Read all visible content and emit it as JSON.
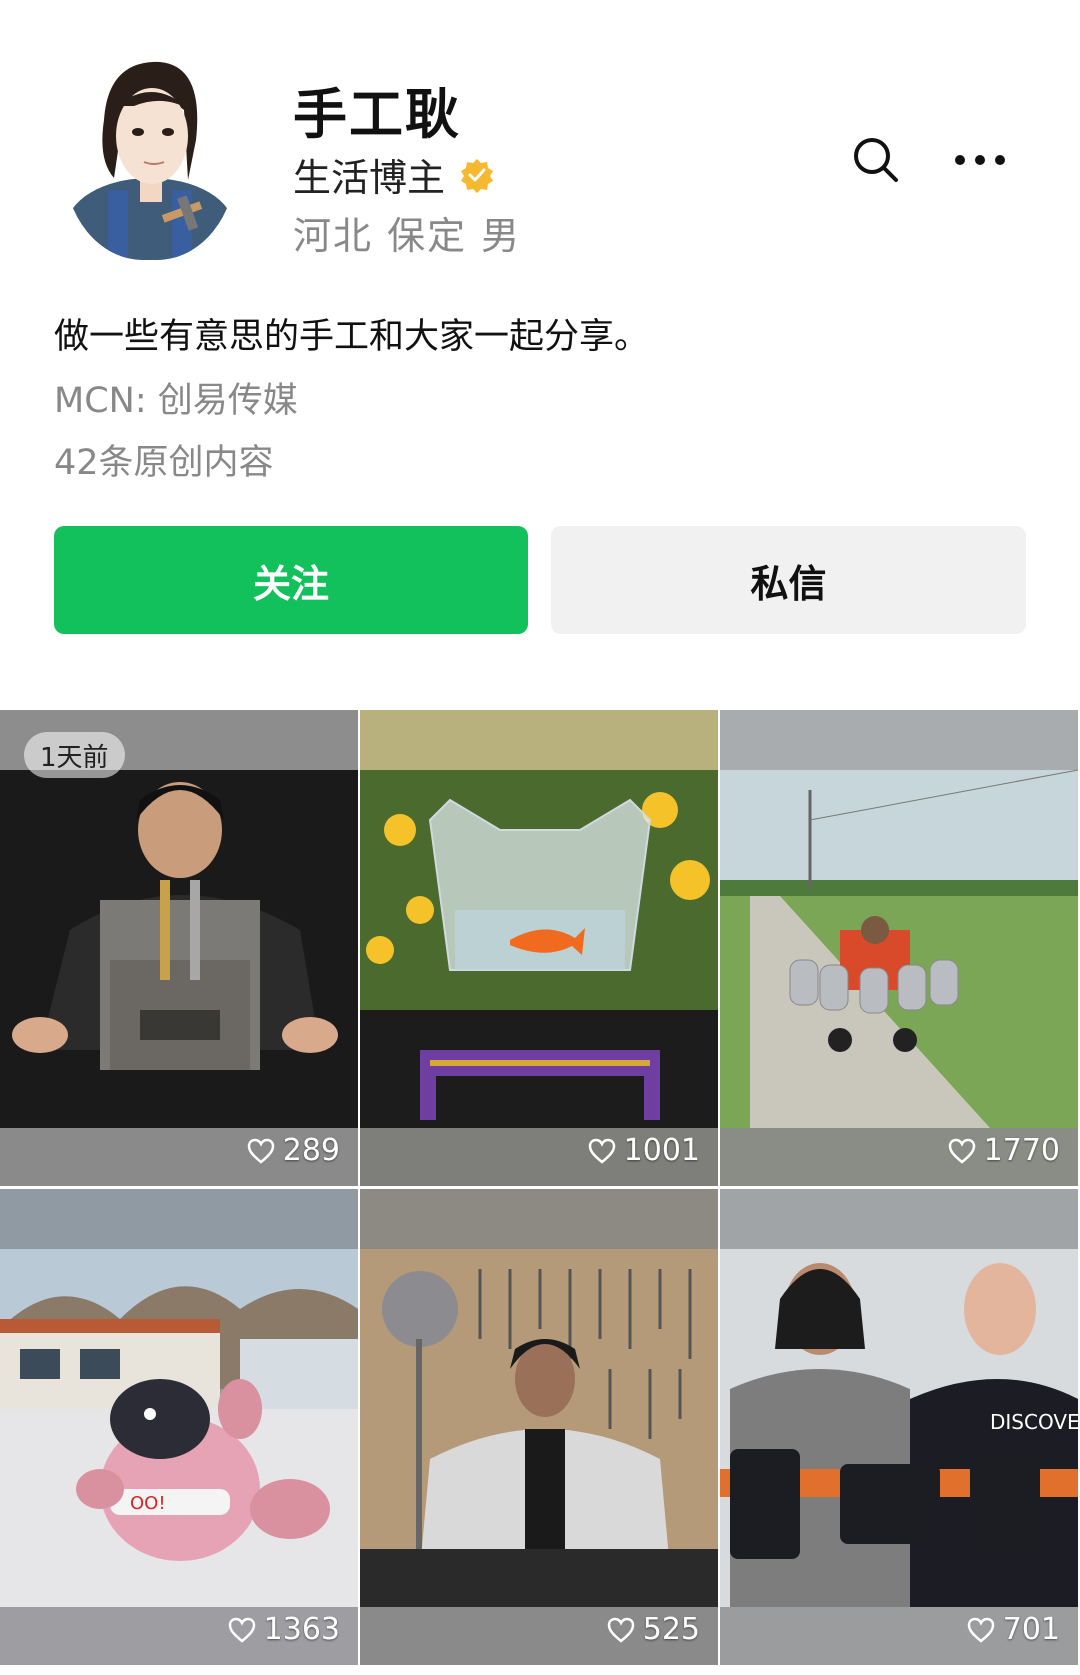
{
  "profile": {
    "name": "手工耿",
    "role": "生活博主",
    "location": "河北 保定 男",
    "bio": "做一些有意思的手工和大家一起分享。",
    "mcn": "MCN: 创易传媒",
    "count": "42条原创内容",
    "verified_icon": "verified-badge-icon",
    "accent": "#12c05c"
  },
  "actions": {
    "follow_label": "关注",
    "message_label": "私信"
  },
  "videos": [
    {
      "badge": "1天前",
      "likes": "289"
    },
    {
      "badge": "",
      "likes": "1001"
    },
    {
      "badge": "",
      "likes": "1770"
    },
    {
      "badge": "",
      "likes": "1363"
    },
    {
      "badge": "",
      "likes": "525"
    },
    {
      "badge": "",
      "likes": "701"
    }
  ]
}
